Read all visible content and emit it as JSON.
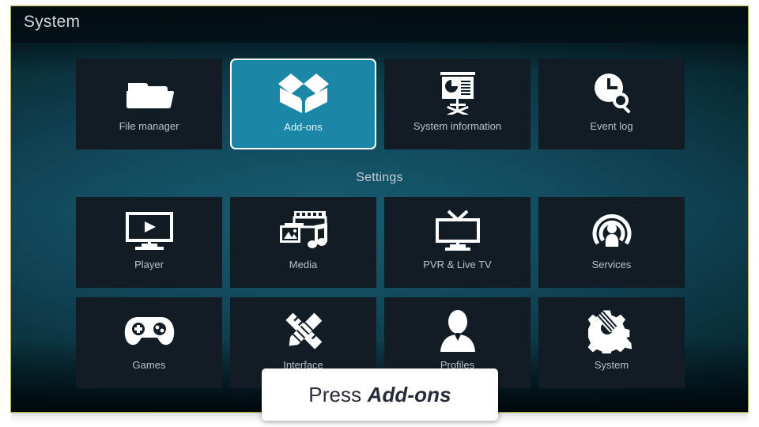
{
  "window": {
    "title": "System",
    "border_color": "#b5ad3e",
    "background_color": "#12586d"
  },
  "header": {
    "title": "System"
  },
  "sections": {
    "settings_heading": "Settings"
  },
  "top_row": {
    "tiles": [
      {
        "label": "File manager",
        "icon": "folder-icon",
        "selected": false
      },
      {
        "label": "Add-ons",
        "icon": "open-box-icon",
        "selected": true
      },
      {
        "label": "System information",
        "icon": "presentation-board-icon",
        "selected": false
      },
      {
        "label": "Event log",
        "icon": "clock-search-icon",
        "selected": false
      }
    ]
  },
  "settings_row": {
    "tiles": [
      {
        "label": "Player",
        "icon": "monitor-play-icon",
        "selected": false
      },
      {
        "label": "Media",
        "icon": "film-photo-music-icon",
        "selected": false
      },
      {
        "label": "PVR & Live TV",
        "icon": "tv-antenna-icon",
        "selected": false
      },
      {
        "label": "Services",
        "icon": "broadcast-person-icon",
        "selected": false
      }
    ]
  },
  "bottom_row": {
    "tiles": [
      {
        "label": "Games",
        "icon": "gamepad-icon",
        "selected": false
      },
      {
        "label": "Interface",
        "icon": "pencil-ruler-icon",
        "selected": false
      },
      {
        "label": "Profiles",
        "icon": "person-icon",
        "selected": false
      },
      {
        "label": "System",
        "icon": "gear-wrench-icon",
        "selected": false
      }
    ]
  },
  "tooltip": {
    "prefix": "Press ",
    "emphasis": "Add-ons"
  },
  "colors": {
    "selected_tile": "#1b87a8",
    "tile_background": "#121c24",
    "label_text": "#b7c3cb",
    "tooltip_background": "#ffffff",
    "tooltip_text": "#262b3a"
  }
}
